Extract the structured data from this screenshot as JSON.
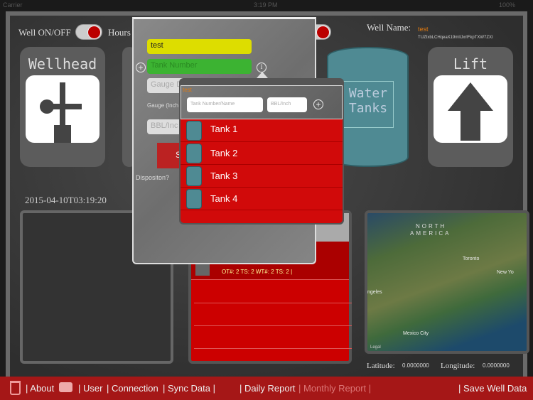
{
  "status": {
    "carrier": "Carrier",
    "time": "3:19 PM",
    "battery": "100%"
  },
  "header": {
    "well_toggle_label": "Well ON/OFF",
    "hours_label": "Hours",
    "well_name_label": "Well Name:",
    "well_name": "test",
    "well_id": "TUZIxbLCHqeaX19mlIJxrlFkpTXW7ZXI"
  },
  "tiles": {
    "wellhead": "Wellhead",
    "water_tanks_line1": "Water",
    "water_tanks_line2": "Tanks",
    "lift": "Lift"
  },
  "timestamp": "2015-04-10T03:19:20",
  "middle_list": {
    "row_text": "OT#: 2 TS: 2 WT#: 2 TS: 2 |"
  },
  "map": {
    "label_north": "NORTH",
    "label_america": "AMERICA",
    "toronto": "Toronto",
    "new_york": "New Yo",
    "los_angeles": "ngeles",
    "mexico_city": "Mexico City",
    "legal": "Legal"
  },
  "coords": {
    "lat_label": "Latitude:",
    "lat": "0.0000000",
    "lon_label": "Longitude:",
    "lon": "0.0000000"
  },
  "popover_form": {
    "name_value": "test",
    "tank_number_placeholder": "Tank Number",
    "gauge_placeholder": "Gauge D",
    "gauge_label": "Gauge (Inch",
    "bbl_placeholder": "BBL/Inc",
    "button_label": "S",
    "disposition_label": "Dispositon?"
  },
  "tank_popover": {
    "title": "test",
    "name_placeholder": "Tank Number/Name",
    "bbl_placeholder": "BBL/Inch",
    "tanks": [
      "Tank 1",
      "Tank 2",
      "Tank 3",
      "Tank 4"
    ]
  },
  "bottom_bar": {
    "about": "| About",
    "user": "| User",
    "connection": "| Connection",
    "sync": "| Sync Data |",
    "daily": "| Daily Report",
    "monthly": "| Monthly Report |",
    "save": "| Save Well Data"
  },
  "colors": {
    "accent_red": "#cc1111",
    "yellow": "#dddd00",
    "green": "#3cb332",
    "orange": "#e07a10"
  }
}
